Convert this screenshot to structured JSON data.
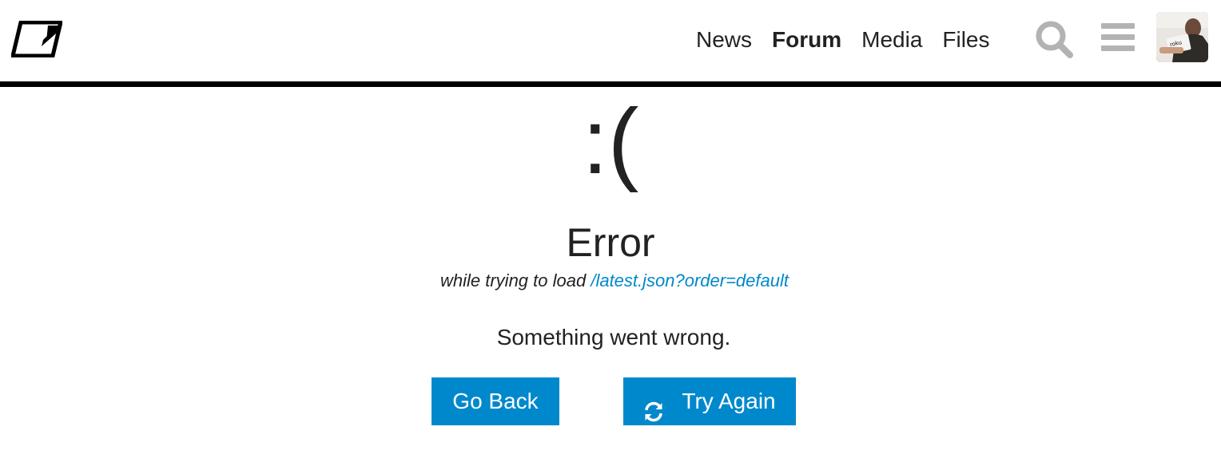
{
  "header": {
    "logo_icon": "square-slash-logo-icon",
    "nav": [
      {
        "label": "News",
        "active": false
      },
      {
        "label": "Forum",
        "active": true
      },
      {
        "label": "Media",
        "active": false
      },
      {
        "label": "Files",
        "active": false
      }
    ],
    "search_icon": "search-icon",
    "menu_icon": "hamburger-menu-icon",
    "avatar_icon": "user-avatar"
  },
  "error": {
    "face": ":(",
    "title": "Error",
    "subtitle_prefix": "while trying to load ",
    "subtitle_url": "/latest.json?order=default",
    "message": "Something went wrong."
  },
  "buttons": {
    "back_label": "Go Back",
    "retry_label": "Try Again",
    "retry_icon": "refresh-icon"
  },
  "colors": {
    "accent": "#0088cc",
    "text": "#222222",
    "icon_gray": "#b3b3b3",
    "header_rule": "#000000"
  }
}
